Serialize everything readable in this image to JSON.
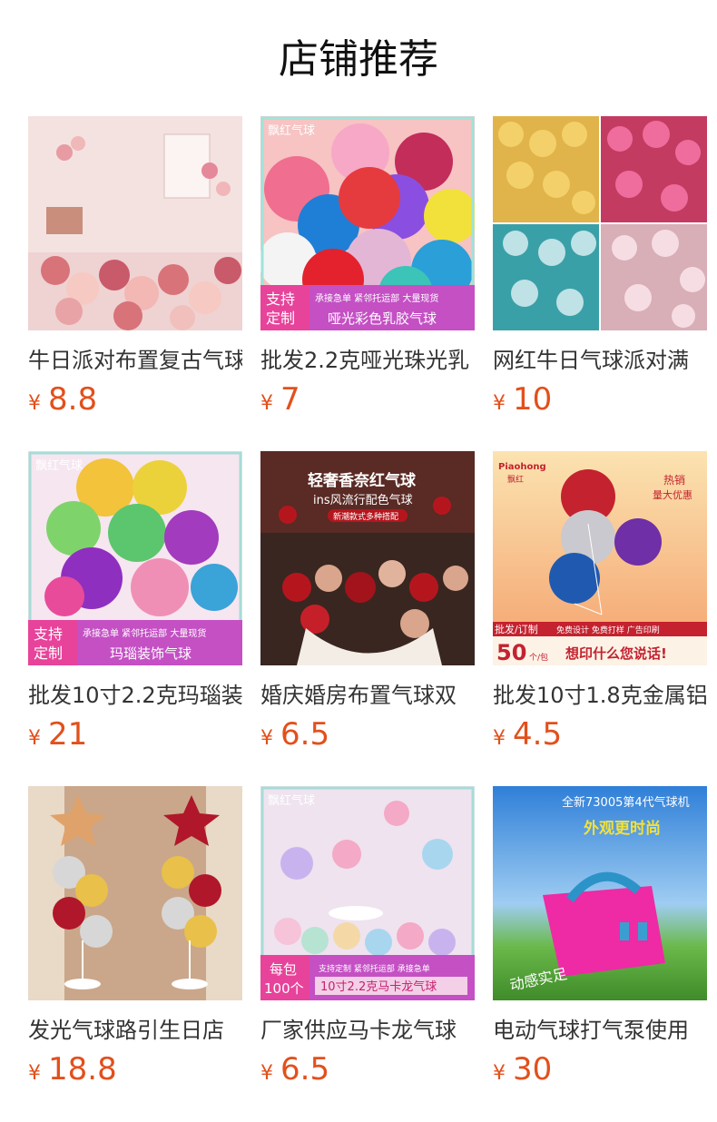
{
  "section_title": "店铺推荐",
  "currency": "¥",
  "products": [
    {
      "name": "牛日派对布置复古气球",
      "price": "8.8",
      "image_text": [],
      "colors": {
        "bg": "#f2d6d6",
        "accent": "#d8737a",
        "accent2": "#f6c9c2"
      }
    },
    {
      "name": "批发2.2克哑光珠光乳",
      "price": "7",
      "image_text": [
        "飘红气球",
        "支持",
        "定制",
        "承接急单 紧邻托运部 大量现货",
        "哑光彩色乳胶气球"
      ],
      "colors": {
        "bg": "#f7c3c3",
        "accent": "#e53b5a",
        "accent2": "#2a9fd8"
      }
    },
    {
      "name": "网红牛日气球派对满",
      "price": "10",
      "image_text": [],
      "colors": {
        "bg": "#d9c6a5",
        "accent": "#c43b62",
        "accent2": "#3aa0a8"
      }
    },
    {
      "name": "批发10寸2.2克玛瑙装",
      "price": "21",
      "image_text": [
        "飘红气球",
        "支持",
        "定制",
        "承接急单 紧邻托运部 大量现货",
        "玛瑙装饰气球"
      ],
      "colors": {
        "bg": "#f6e6f0",
        "accent": "#a23bbd",
        "accent2": "#f2c33b"
      }
    },
    {
      "name": "婚庆婚房布置气球双",
      "price": "6.5",
      "image_text": [
        "轻奢香奈红气球",
        "ins风流行配色气球",
        "新潮款式多种搭配"
      ],
      "colors": {
        "bg": "#3a2620",
        "accent": "#b5161e",
        "accent2": "#d9a58c"
      }
    },
    {
      "name": "批发10寸1.8克金属铝",
      "price": "4.5",
      "image_text": [
        "Piaohong",
        "飘红",
        "热销",
        "量大优惠",
        "批发/订制",
        "免费设计 免费打样 广告印刷",
        "50",
        "个/包",
        "想印什么您说话!"
      ],
      "colors": {
        "bg": "#f4b98c",
        "accent": "#c4222f",
        "accent2": "#6f2fa6"
      }
    },
    {
      "name": "发光气球路引生日店",
      "price": "18.8",
      "image_text": [],
      "colors": {
        "bg": "#caa78a",
        "accent": "#b0172a",
        "accent2": "#e9c04a"
      }
    },
    {
      "name": "厂家供应马卡龙气球",
      "price": "6.5",
      "image_text": [
        "飘红气球",
        "每包",
        "100个",
        "支持定制 紧邻托运部 承接急单",
        "10寸2.2克马卡龙气球"
      ],
      "colors": {
        "bg": "#eee3ef",
        "accent": "#f4a9c6",
        "accent2": "#a9d6ef"
      }
    },
    {
      "name": "电动气球打气泵使用",
      "price": "30",
      "image_text": [
        "全新73005第4代气球机",
        "外观更时尚",
        "动感实足"
      ],
      "colors": {
        "bg": "#3c8ce0",
        "accent": "#ee2aa5",
        "accent2": "#6ab94a"
      }
    }
  ]
}
